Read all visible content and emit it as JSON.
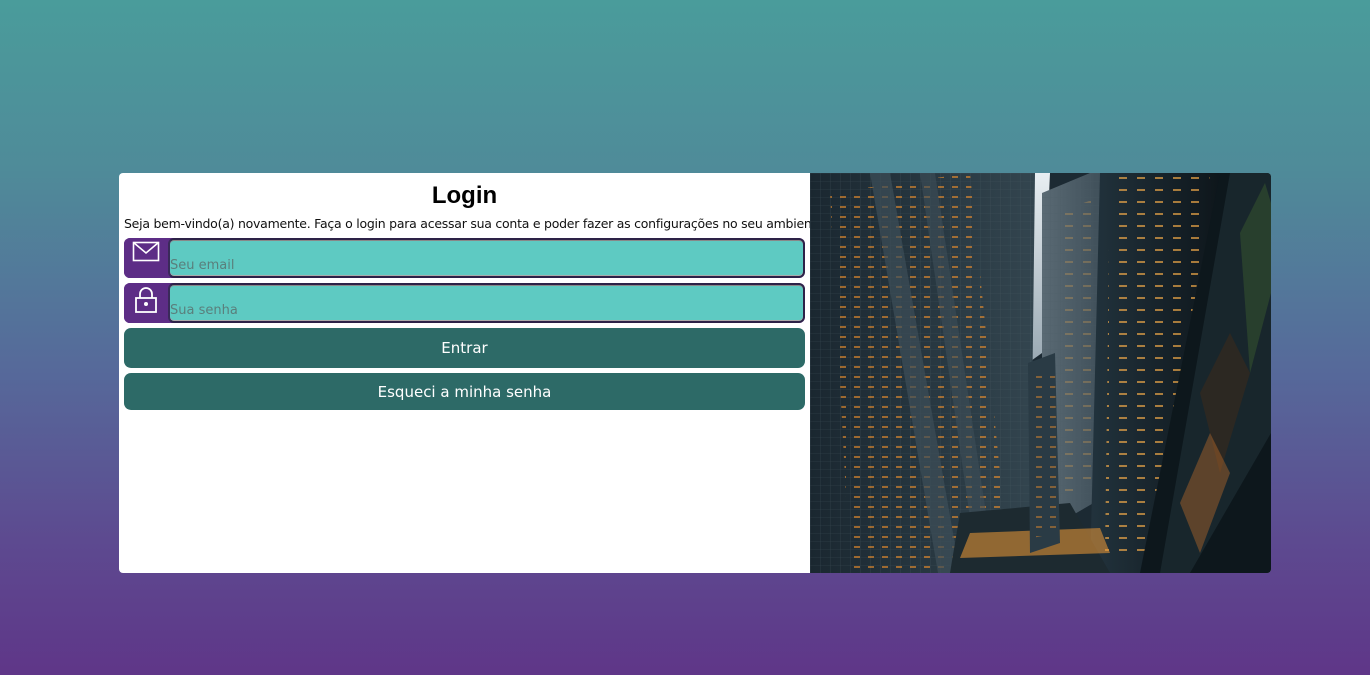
{
  "login": {
    "title": "Login",
    "subtitle": "Seja bem-vindo(a) novamente. Faça o login para acessar sua conta e poder fazer as configurações no seu ambiente.",
    "email": {
      "placeholder": "Seu email",
      "value": "",
      "icon": "envelope-icon"
    },
    "password": {
      "placeholder": "Sua senha",
      "value": "",
      "icon": "lock-icon"
    },
    "login_button": "Entrar",
    "forgot_button": "Esqueci a minha senha"
  },
  "colors": {
    "accent_purple": "#5d2d86",
    "input_teal": "#5ecac2",
    "button_green": "#2d6a67",
    "bg_top": "#4a9c9b",
    "bg_bottom": "#5f3688"
  }
}
